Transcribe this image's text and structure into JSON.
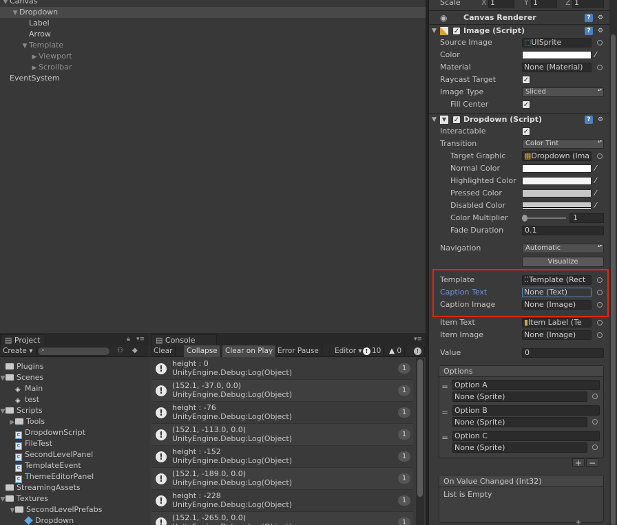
{
  "hierarchy": {
    "items": [
      {
        "label": "Canvas",
        "indent": 0,
        "arrow": "open",
        "selected": false,
        "dim": false
      },
      {
        "label": "Dropdown",
        "indent": 1,
        "arrow": "open",
        "selected": true,
        "dim": false
      },
      {
        "label": "Label",
        "indent": 2,
        "arrow": "",
        "selected": false,
        "dim": false
      },
      {
        "label": "Arrow",
        "indent": 2,
        "arrow": "",
        "selected": false,
        "dim": false
      },
      {
        "label": "Template",
        "indent": 2,
        "arrow": "open",
        "selected": false,
        "dim": true
      },
      {
        "label": "Viewport",
        "indent": 3,
        "arrow": "closed",
        "selected": false,
        "dim": true
      },
      {
        "label": "Scrollbar",
        "indent": 3,
        "arrow": "closed",
        "selected": false,
        "dim": true
      },
      {
        "label": "EventSystem",
        "indent": 0,
        "arrow": "",
        "selected": false,
        "dim": false
      }
    ]
  },
  "project": {
    "tab": "Project",
    "create": "Create",
    "items": [
      {
        "label": "Plugins",
        "type": "folder",
        "indent": 0,
        "arrow": ""
      },
      {
        "label": "Scenes",
        "type": "folder",
        "indent": 0,
        "arrow": "open"
      },
      {
        "label": "Main",
        "type": "scene",
        "indent": 1,
        "arrow": ""
      },
      {
        "label": "test",
        "type": "scene",
        "indent": 1,
        "arrow": ""
      },
      {
        "label": "Scripts",
        "type": "folder",
        "indent": 0,
        "arrow": "open"
      },
      {
        "label": "Tools",
        "type": "folder",
        "indent": 1,
        "arrow": "closed"
      },
      {
        "label": "DropdownScript",
        "type": "cs",
        "indent": 1,
        "arrow": ""
      },
      {
        "label": "FileTest",
        "type": "cs",
        "indent": 1,
        "arrow": ""
      },
      {
        "label": "SecondLevelPanel",
        "type": "cs",
        "indent": 1,
        "arrow": ""
      },
      {
        "label": "TemplateEvent",
        "type": "cs",
        "indent": 1,
        "arrow": ""
      },
      {
        "label": "ThemeEditorPanel",
        "type": "cs",
        "indent": 1,
        "arrow": ""
      },
      {
        "label": "StreamingAssets",
        "type": "folder",
        "indent": 0,
        "arrow": ""
      },
      {
        "label": "Textures",
        "type": "folder",
        "indent": 0,
        "arrow": "open"
      },
      {
        "label": "SecondLevelPrefabs",
        "type": "folder",
        "indent": 1,
        "arrow": "open"
      },
      {
        "label": "Dropdown",
        "type": "prefab",
        "indent": 2,
        "arrow": ""
      }
    ]
  },
  "console": {
    "tab": "Console",
    "buttons": [
      "Clear",
      "Collapse",
      "Clear on Play",
      "Error Pause",
      "Editor"
    ],
    "active_buttons": [
      1,
      2
    ],
    "log_count": "10",
    "warn_count": "0",
    "entries": [
      {
        "line1": "height : 0",
        "line2": "UnityEngine.Debug:Log(Object)",
        "count": "1"
      },
      {
        "line1": "(152.1, -37.0, 0.0)",
        "line2": "UnityEngine.Debug:Log(Object)",
        "count": "1"
      },
      {
        "line1": "height : -76",
        "line2": "UnityEngine.Debug:Log(Object)",
        "count": "1"
      },
      {
        "line1": "(152.1, -113.0, 0.0)",
        "line2": "UnityEngine.Debug:Log(Object)",
        "count": "1"
      },
      {
        "line1": "height : -152",
        "line2": "UnityEngine.Debug:Log(Object)",
        "count": "1"
      },
      {
        "line1": "(152.1, -189.0, 0.0)",
        "line2": "UnityEngine.Debug:Log(Object)",
        "count": "1"
      },
      {
        "line1": "height : -228",
        "line2": "UnityEngine.Debug:Log(Object)",
        "count": "1"
      },
      {
        "line1": "(152.1, -265.0, 0.0)",
        "line2": "UnityEngine.Debug:Log(Object)",
        "count": "1"
      }
    ]
  },
  "inspector": {
    "scale": {
      "label": "Scale",
      "x": "1",
      "y": "1",
      "z": "1"
    },
    "canvas_renderer": "Canvas Renderer",
    "image_script": {
      "title": "Image (Script)",
      "source_image_label": "Source Image",
      "source_image": "UISprite",
      "color_label": "Color",
      "material_label": "Material",
      "material": "None (Material)",
      "raycast_label": "Raycast Target",
      "image_type_label": "Image Type",
      "image_type": "Sliced",
      "fill_center_label": "Fill Center"
    },
    "dropdown_script": {
      "title": "Dropdown (Script)",
      "interactable_label": "Interactable",
      "transition_label": "Transition",
      "transition": "Color Tint",
      "target_graphic_label": "Target Graphic",
      "target_graphic": "Dropdown (Ima",
      "normal_color_label": "Normal Color",
      "highlighted_color_label": "Highlighted Color",
      "pressed_color_label": "Pressed Color",
      "disabled_color_label": "Disabled Color",
      "color_multiplier_label": "Color Multiplier",
      "color_multiplier": "1",
      "fade_duration_label": "Fade Duration",
      "fade_duration": "0.1",
      "navigation_label": "Navigation",
      "navigation": "Automatic",
      "visualize": "Visualize",
      "template_label": "Template",
      "template": "Template (Rect",
      "caption_text_label": "Caption Text",
      "caption_text": "None (Text)",
      "caption_image_label": "Caption Image",
      "caption_image": "None (Image)",
      "item_text_label": "Item Text",
      "item_text": "Item Label (Te",
      "item_image_label": "Item Image",
      "item_image": "None (Image)",
      "value_label": "Value",
      "value": "0",
      "options_label": "Options",
      "options": [
        {
          "text": "Option A",
          "sprite": "None (Sprite)"
        },
        {
          "text": "Option B",
          "sprite": "None (Sprite)"
        },
        {
          "text": "Option C",
          "sprite": "None (Sprite)"
        }
      ],
      "on_value_changed": "On Value Changed (Int32)",
      "list_empty": "List is Empty"
    },
    "colors": {
      "highlight_box": "#e2231a",
      "caption_label": "#6e95e6",
      "pressed": "#c8c8c8"
    }
  }
}
